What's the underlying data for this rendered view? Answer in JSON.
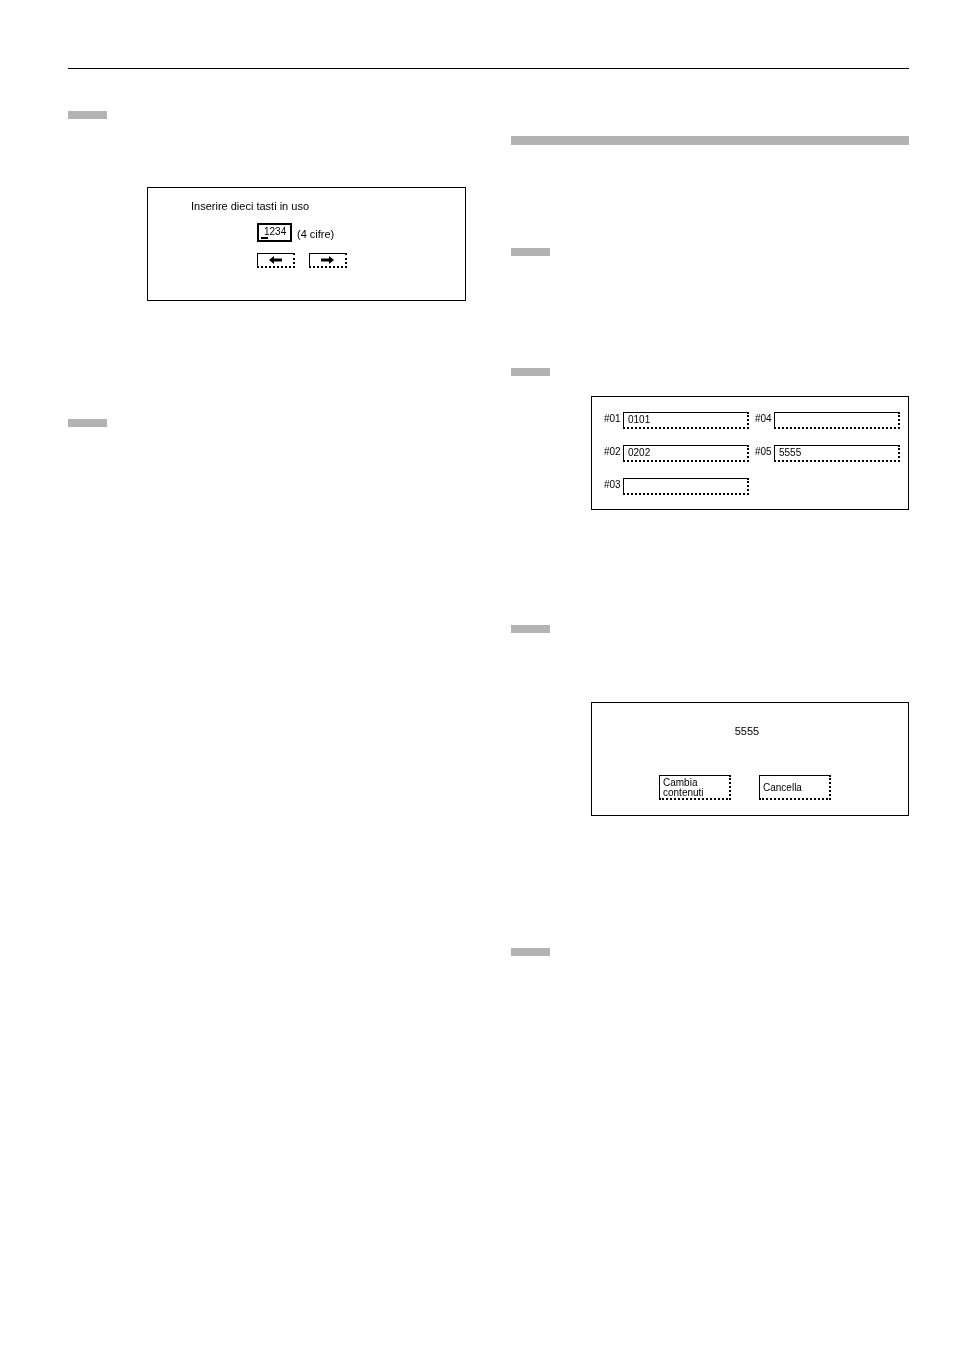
{
  "left_column": [
    {
      "kind": "step_marker"
    },
    {
      "kind": "entry_screen",
      "prompt": "Inserire dieci tasti in uso",
      "code_field": {
        "value": "1234",
        "cursor": true
      },
      "hint": "(4 cifre)",
      "arrow_buttons": [
        {
          "kind": "left"
        },
        {
          "kind": "right"
        }
      ]
    },
    {
      "kind": "step_marker"
    }
  ],
  "right_column": [
    {
      "kind": "heading_bar"
    },
    {
      "kind": "step_marker"
    },
    {
      "kind": "step_marker"
    },
    {
      "kind": "slot_screen",
      "slots": [
        {
          "label": "#01",
          "value": "0101"
        },
        {
          "label": "#02",
          "value": "0202"
        },
        {
          "label": "#03"
        },
        {
          "label": "#04"
        },
        {
          "label": "#05",
          "value": "5555"
        }
      ]
    },
    {
      "kind": "step_marker"
    },
    {
      "kind": "confirm_screen",
      "code": "5555",
      "buttons": [
        "Cambia contenuti",
        "Cancella"
      ]
    },
    {
      "kind": "step_marker"
    }
  ]
}
